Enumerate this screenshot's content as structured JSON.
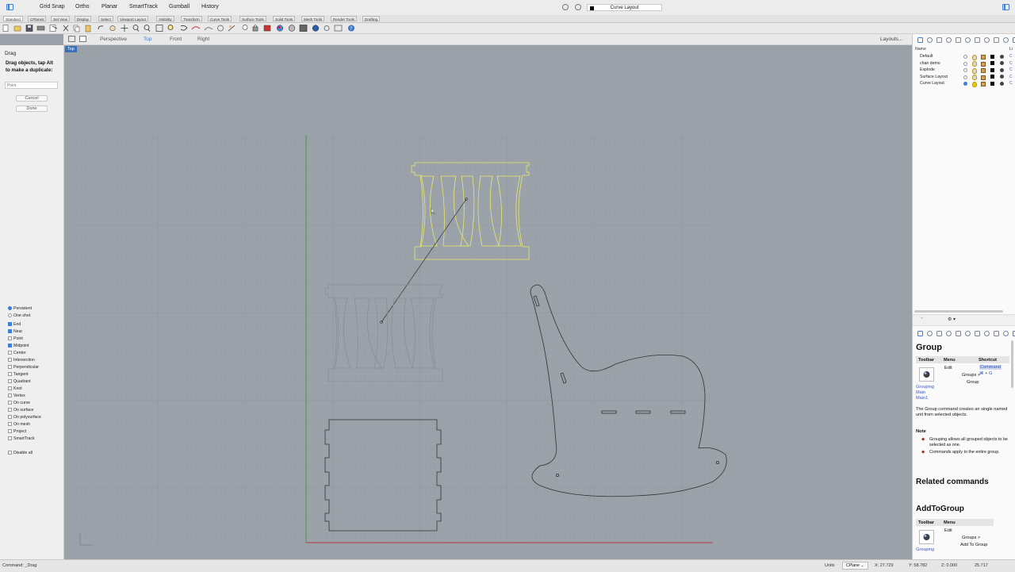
{
  "titlebar": {
    "toggles": [
      "Grid Snap",
      "Ortho",
      "Planar",
      "SmartTrack",
      "Gumball",
      "History"
    ],
    "document_layer": "Curve Layout"
  },
  "tabs": [
    "Standard",
    "CPlanes",
    "Set View",
    "Display",
    "Select",
    "Viewport Layout",
    "Visibility",
    "Transform",
    "Curve Tools",
    "Surface Tools",
    "Solid Tools",
    "Mesh Tools",
    "Render Tools",
    "Drafting"
  ],
  "viewbar": {
    "views": [
      "Perspective",
      "Top",
      "Front",
      "Right"
    ],
    "active": "Top",
    "layouts_label": "Layouts..."
  },
  "command": {
    "heading": "Drag",
    "prompt": "Drag objects, tap Alt to make a duplicate:",
    "input_placeholder": "Point",
    "cancel_label": "Cancel",
    "done_label": "Done"
  },
  "osnap": {
    "modes": [
      {
        "label": "Persistent",
        "checked": true,
        "radio": true
      },
      {
        "label": "One shot",
        "checked": false,
        "radio": true
      }
    ],
    "items": [
      {
        "label": "End",
        "checked": true
      },
      {
        "label": "Near",
        "checked": true
      },
      {
        "label": "Point",
        "checked": false
      },
      {
        "label": "Midpoint",
        "checked": true
      },
      {
        "label": "Center",
        "checked": false
      },
      {
        "label": "Intersection",
        "checked": false
      },
      {
        "label": "Perpendicular",
        "checked": false
      },
      {
        "label": "Tangent",
        "checked": false
      },
      {
        "label": "Quadrant",
        "checked": false
      },
      {
        "label": "Knot",
        "checked": false
      },
      {
        "label": "Vertex",
        "checked": false
      },
      {
        "label": "On curve",
        "checked": false
      },
      {
        "label": "On surface",
        "checked": false
      },
      {
        "label": "On polysurface",
        "checked": false
      },
      {
        "label": "On mesh",
        "checked": false
      },
      {
        "label": "Project",
        "checked": false
      },
      {
        "label": "SmartTrack",
        "checked": false
      }
    ],
    "disable_all": "Disable all"
  },
  "viewport": {
    "label": "Top"
  },
  "layers": {
    "header_name": "Name",
    "header_right": "Li",
    "rows": [
      {
        "name": "Default",
        "current": false
      },
      {
        "name": "chair demo",
        "current": false
      },
      {
        "name": "Explode",
        "current": false
      },
      {
        "name": "Surface Layout",
        "current": false
      },
      {
        "name": "Curve Layout",
        "current": true
      }
    ]
  },
  "help": {
    "title": "Group",
    "columns": [
      "Toolbar",
      "Menu",
      "Shortcut"
    ],
    "menu_lines": [
      "Edit",
      "Groups >",
      "Group"
    ],
    "shortcut_text": "Command",
    "shortcut_keys": "⌘ + G",
    "toolbar_links": [
      "Grouping",
      "Main",
      "Main1"
    ],
    "description": "The Group command creates an single named unit from selected objects.",
    "note_heading": "Note",
    "notes": [
      "Grouping allows all grouped objects to be selected as one.",
      "Commands apply to the entire group."
    ],
    "related_heading": "Related commands",
    "related_title": "AddToGroup",
    "related_columns": [
      "Toolbar",
      "Menu"
    ],
    "related_menu_lines": [
      "Edit",
      "Groups >",
      "Add To Group"
    ],
    "related_toolbar_link": "Grouping"
  },
  "status": {
    "command": "Command: _Drag",
    "units": "Units",
    "cplane": "CPlane",
    "x": "X: 27.729",
    "y": "Y: 58.782",
    "z": "Z: 0.000",
    "extra": "25.717"
  },
  "colors": {
    "viewport_bg": "#9ba1a9",
    "selected_curve": "#e6e96a",
    "x_axis": "#b04040",
    "y_axis": "#3f9a3f",
    "accent": "#3b7fd8"
  }
}
